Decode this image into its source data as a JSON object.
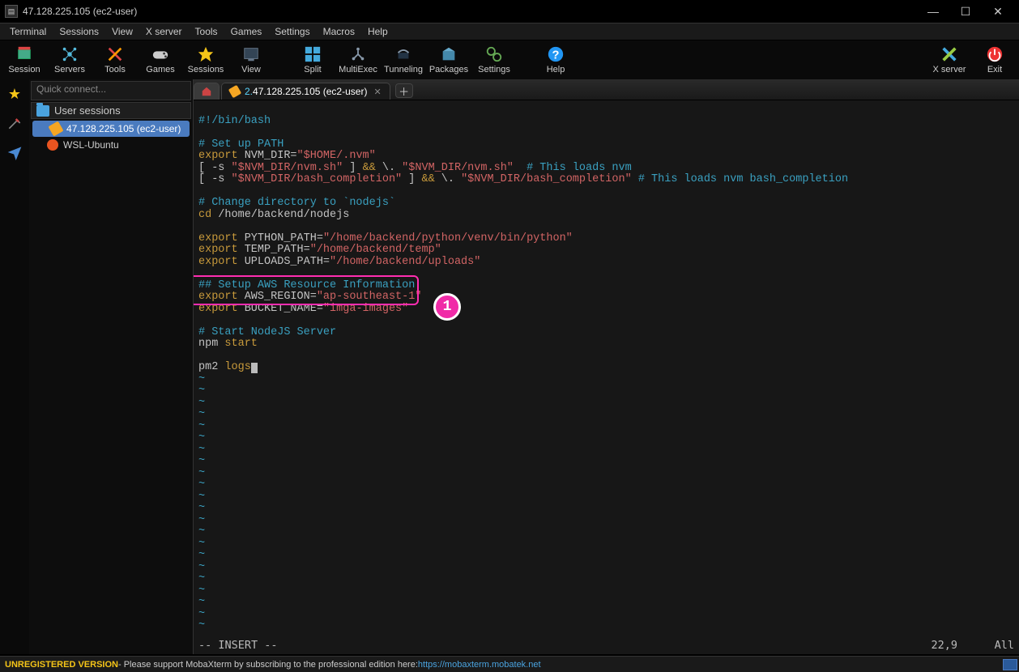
{
  "window": {
    "title": "47.128.225.105 (ec2-user)"
  },
  "menu": [
    "Terminal",
    "Sessions",
    "View",
    "X server",
    "Tools",
    "Games",
    "Settings",
    "Macros",
    "Help"
  ],
  "toolbar": [
    "Session",
    "Servers",
    "Tools",
    "Games",
    "Sessions",
    "View",
    "",
    "Split",
    "MultiExec",
    "Tunneling",
    "Packages",
    "Settings",
    "",
    "Help"
  ],
  "toolbar_right": [
    "X server",
    "Exit"
  ],
  "quickconnect_placeholder": "Quick connect...",
  "sessions": {
    "header": "User sessions",
    "items": [
      {
        "label": "47.128.225.105 (ec2-user)",
        "selected": true,
        "icon": "wrench"
      },
      {
        "label": "WSL-Ubuntu",
        "selected": false,
        "icon": "ubuntu"
      }
    ]
  },
  "tabs": {
    "active": {
      "num": "2.",
      "label": " 47.128.225.105 (ec2-user)"
    }
  },
  "code": {
    "l1": "#!/bin/bash",
    "l3": "# Set up PATH",
    "l4a": "export",
    "l4b": " NVM_DIR=",
    "l4c": "\"$HOME/.nvm\"",
    "l5a": "[ -s ",
    "l5b": "\"$NVM_DIR/nvm.sh\"",
    "l5c": " ] ",
    "l5d": "&&",
    "l5e": " \\. ",
    "l5f": "\"$NVM_DIR/nvm.sh\"",
    "l5g": "  # This loads nvm",
    "l6a": "[ -s ",
    "l6b": "\"$NVM_DIR/bash_completion\"",
    "l6c": " ] ",
    "l6d": "&&",
    "l6e": " \\. ",
    "l6f": "\"$NVM_DIR/bash_completion\"",
    "l6g": " # This loads nvm bash_completion",
    "l8": "# Change directory to `nodejs`",
    "l9a": "cd",
    "l9b": " /home/backend/nodejs",
    "l11a": "export",
    "l11b": " PYTHON_PATH=",
    "l11c": "\"/home/backend/python/venv/bin/python\"",
    "l12a": "export",
    "l12b": " TEMP_PATH=",
    "l12c": "\"/home/backend/temp\"",
    "l13a": "export",
    "l13b": " UPLOADS_PATH=",
    "l13c": "\"/home/backend/uploads\"",
    "l15": "## Setup AWS Resource Information",
    "l16a": "export",
    "l16b": " AWS_REGION=",
    "l16c": "\"ap-southeast-1\"",
    "l17a": "export",
    "l17b": " BUCKET_NAME=",
    "l17c": "\"imga-images\"",
    "l19": "# Start NodeJS Server",
    "l20a": "npm ",
    "l20b": "start",
    "l22a": "pm2 ",
    "l22b": "logs",
    "mode": "-- INSERT --",
    "pos": "22,9",
    "scroll": "All"
  },
  "annotation": {
    "marker": "1"
  },
  "footer": {
    "badge": "UNREGISTERED VERSION",
    "text": " - Please support MobaXterm by subscribing to the professional edition here: ",
    "url": "https://mobaxterm.mobatek.net"
  }
}
